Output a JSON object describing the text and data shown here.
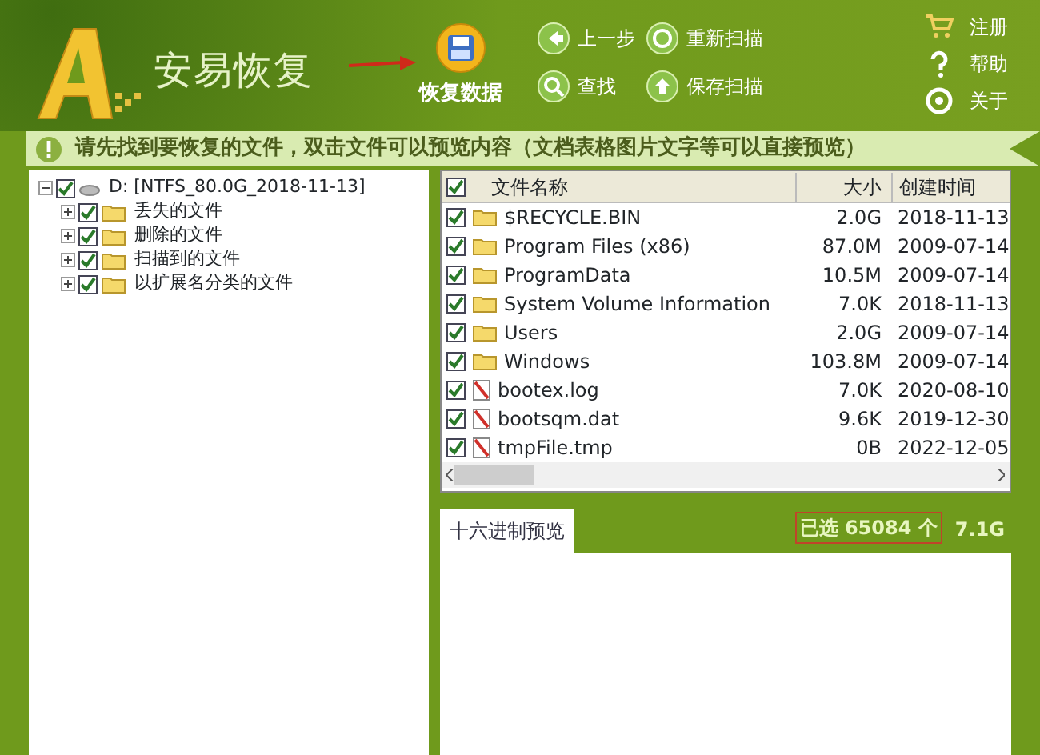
{
  "app": {
    "title": "安易恢复"
  },
  "toolbar": {
    "main": {
      "label": "恢复数据"
    },
    "buttons": [
      {
        "label": "上一步",
        "kind": "back"
      },
      {
        "label": "重新扫描",
        "kind": "rescan"
      },
      {
        "label": "查找",
        "kind": "search"
      },
      {
        "label": "保存扫描",
        "kind": "save"
      }
    ],
    "side": [
      {
        "label": "注册",
        "kind": "cart"
      },
      {
        "label": "帮助",
        "kind": "help"
      },
      {
        "label": "关于",
        "kind": "about"
      }
    ]
  },
  "banner": "请先找到要恢复的文件，双击文件可以预览内容（文档表格图片文字等可以直接预览）",
  "tree": {
    "label": "D:  [NTFS_80.0G_2018-11-13]",
    "checked": true,
    "expanded": true,
    "children": [
      {
        "label": "丢失的文件",
        "checked": true,
        "expanded": false
      },
      {
        "label": "删除的文件",
        "checked": true,
        "expanded": false
      },
      {
        "label": "扫描到的文件",
        "checked": true,
        "expanded": false
      },
      {
        "label": "以扩展名分类的文件",
        "checked": true,
        "expanded": false
      }
    ]
  },
  "table": {
    "all_checked": true,
    "columns": [
      "文件名称",
      "大小",
      "创建时间"
    ],
    "rows": [
      {
        "kind": "folder",
        "checked": true,
        "name": "$RECYCLE.BIN",
        "size": "2.0G",
        "created": "2018-11-13"
      },
      {
        "kind": "folder",
        "checked": true,
        "name": "Program Files (x86)",
        "size": "87.0M",
        "created": "2009-07-14"
      },
      {
        "kind": "folder",
        "checked": true,
        "name": "ProgramData",
        "size": "10.5M",
        "created": "2009-07-14"
      },
      {
        "kind": "folder",
        "checked": true,
        "name": "System Volume Information",
        "size": "7.0K",
        "created": "2018-11-13"
      },
      {
        "kind": "folder",
        "checked": true,
        "name": "Users",
        "size": "2.0G",
        "created": "2009-07-14"
      },
      {
        "kind": "folder",
        "checked": true,
        "name": "Windows",
        "size": "103.8M",
        "created": "2009-07-14"
      },
      {
        "kind": "file",
        "checked": true,
        "name": "bootex.log",
        "size": "7.0K",
        "created": "2020-08-10"
      },
      {
        "kind": "file",
        "checked": true,
        "name": "bootsqm.dat",
        "size": "9.6K",
        "created": "2019-12-30"
      },
      {
        "kind": "file",
        "checked": true,
        "name": "tmpFile.tmp",
        "size": "0B",
        "created": "2022-12-05"
      }
    ]
  },
  "preview": {
    "tabs": [
      {
        "label": "十六进制预览",
        "selected": true
      }
    ],
    "selected_count": "已选 65084 个",
    "selected_size": "7.1G"
  }
}
